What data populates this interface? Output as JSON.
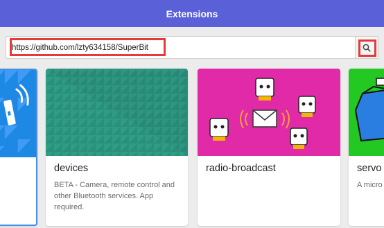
{
  "header": {
    "title": "Extensions"
  },
  "search": {
    "value": "https://github.com/lzty634158/SuperBit",
    "icon": "search-icon"
  },
  "cards": [
    {
      "name": "",
      "description": "",
      "image": "bluetooth-device",
      "color": "#1e88e5"
    },
    {
      "name": "devices",
      "description": "BETA - Camera, remote control and other Bluetooth services. App required.",
      "image": "teal-pattern",
      "color": "#2a8f7b"
    },
    {
      "name": "radio-broadcast",
      "description": "",
      "image": "radio-characters",
      "color": "#e12aa8"
    },
    {
      "name": "servo",
      "description": "A micro",
      "image": "servo-character",
      "color": "#23c823"
    }
  ],
  "highlight_color": "#e53a3a"
}
